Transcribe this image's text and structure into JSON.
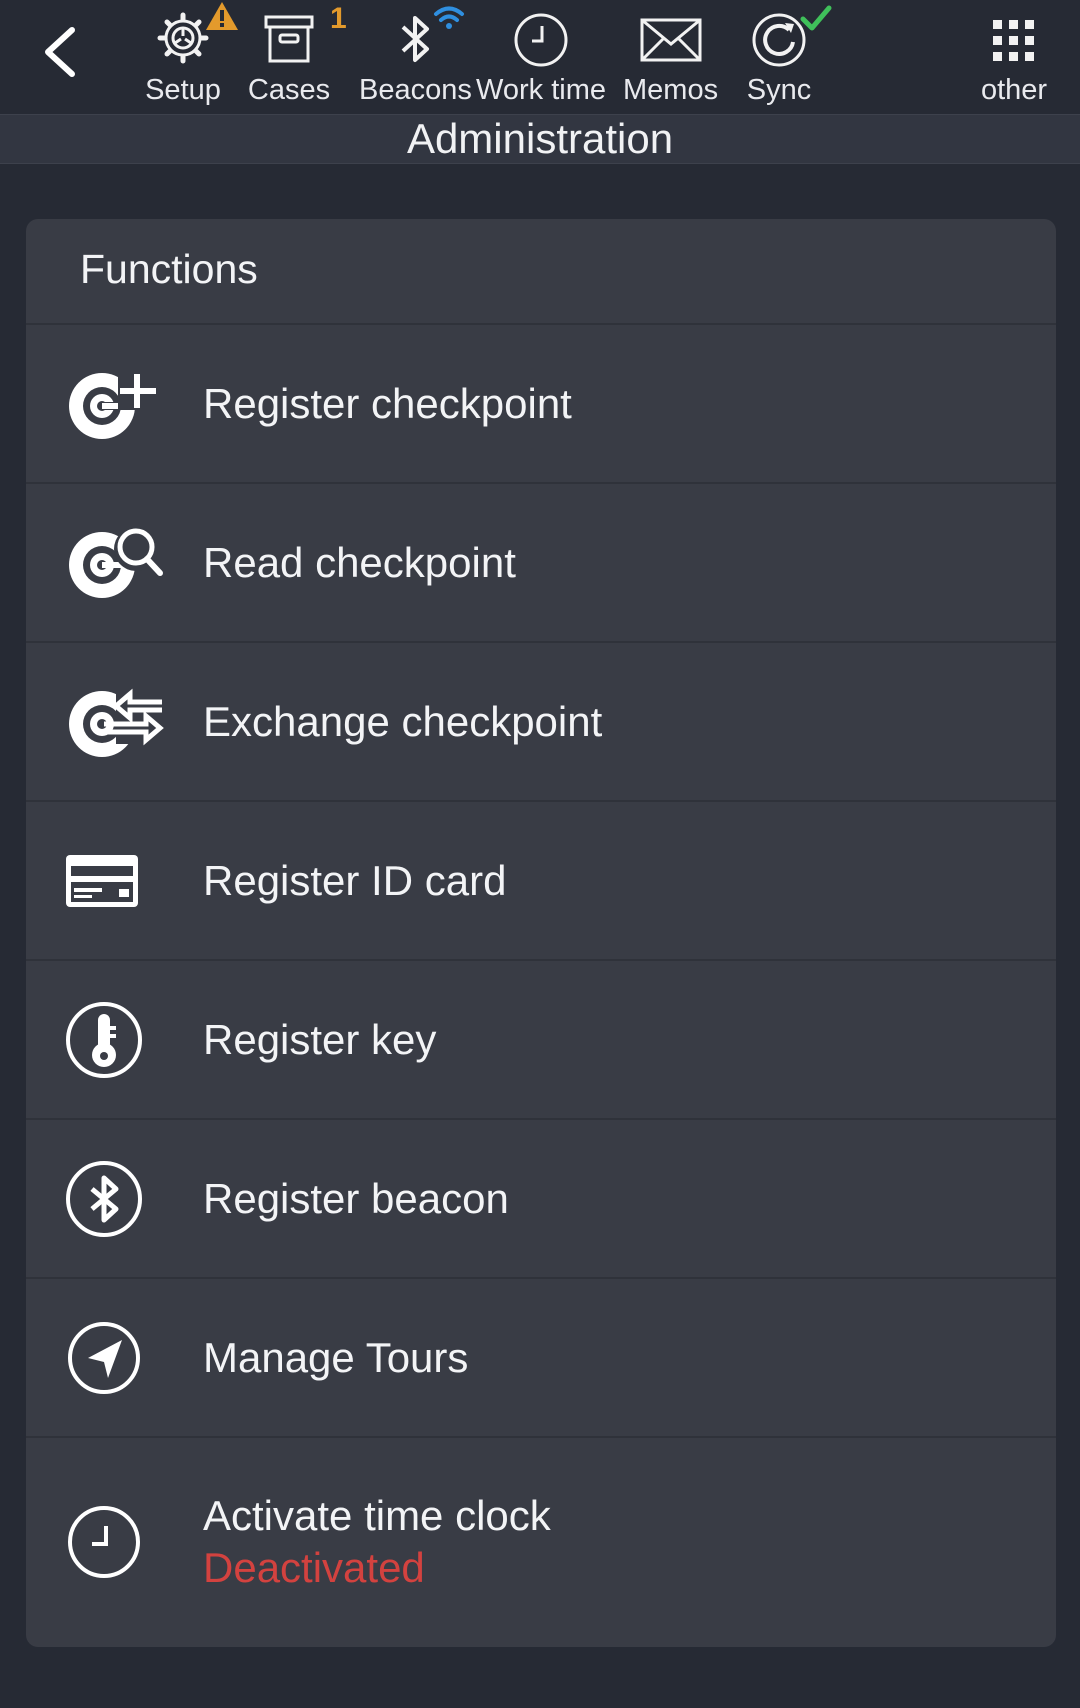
{
  "toolbar": {
    "items": [
      {
        "label": "Setup",
        "icon": "gear-icon",
        "badge_icon": "warning-icon"
      },
      {
        "label": "Cases",
        "icon": "archive-box-icon",
        "badge": "1"
      },
      {
        "label": "Beacons",
        "icon": "bluetooth-icon",
        "badge_icon": "wifi-signal-icon"
      },
      {
        "label": "Work time",
        "icon": "clock-icon"
      },
      {
        "label": "Memos",
        "icon": "envelope-icon"
      },
      {
        "label": "Sync",
        "icon": "sync-icon",
        "badge_icon": "checkmark-icon"
      }
    ],
    "other_label": "other"
  },
  "page_title": "Administration",
  "card": {
    "header": "Functions",
    "rows": [
      {
        "label": "Register checkpoint",
        "icon": "checkpoint-add-icon"
      },
      {
        "label": "Read checkpoint",
        "icon": "checkpoint-search-icon"
      },
      {
        "label": "Exchange checkpoint",
        "icon": "checkpoint-exchange-icon"
      },
      {
        "label": "Register ID card",
        "icon": "id-card-icon"
      },
      {
        "label": "Register key",
        "icon": "key-icon"
      },
      {
        "label": "Register beacon",
        "icon": "bluetooth-circle-icon"
      },
      {
        "label": "Manage Tours",
        "icon": "navigation-icon"
      },
      {
        "label": "Activate time clock",
        "sublabel": "Deactivated",
        "icon": "clock-icon"
      }
    ]
  },
  "colors": {
    "background": "#262a34",
    "card": "#393c45",
    "warning": "#e39a2c",
    "bluetooth_signal": "#2f8fe0",
    "success": "#3fc05a",
    "deactivated": "#d3423f"
  }
}
